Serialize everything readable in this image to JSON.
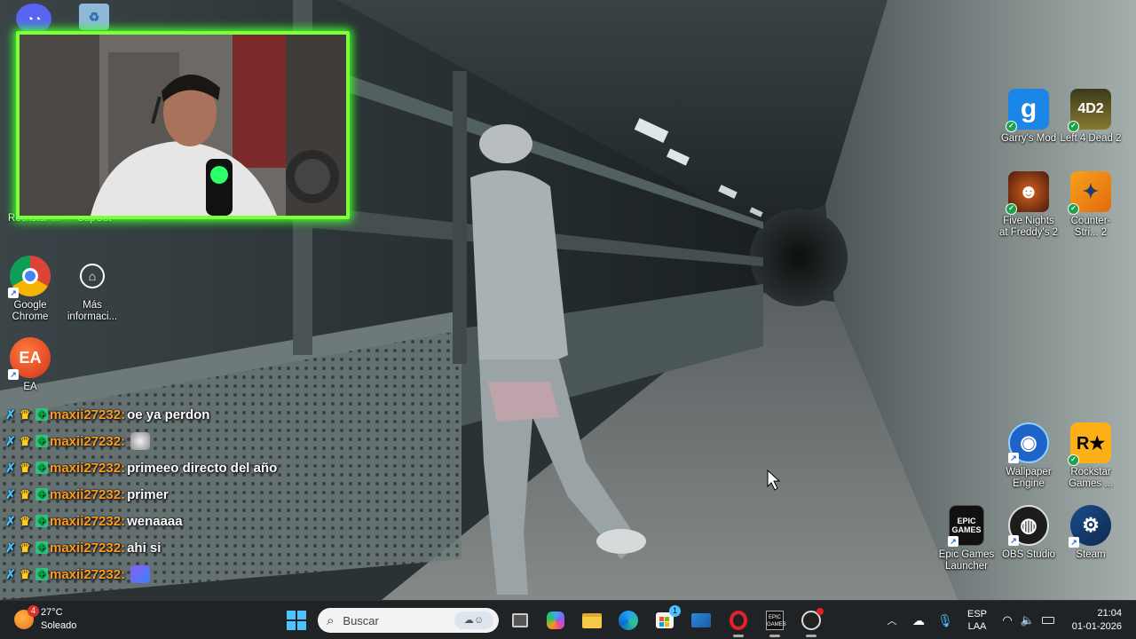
{
  "desktop": {
    "left_icons": [
      {
        "label": "Rockstar ...",
        "icon": "rockstar-icon"
      },
      {
        "label": "CapCut",
        "icon": "capcut-icon"
      },
      {
        "label": "Google Chrome",
        "icon": "chrome-icon"
      },
      {
        "label": "Más informaci...",
        "icon": "info-icon"
      },
      {
        "label": "EA",
        "icon": "ea-icon"
      }
    ],
    "right_icons": [
      {
        "label": "Garry's Mod",
        "icon": "gmod-icon",
        "glyph": "g"
      },
      {
        "label": "Left 4 Dead 2",
        "icon": "l4d2-icon",
        "glyph": "2"
      },
      {
        "label": "Five Nights at Freddy's 2",
        "icon": "fnaf2-icon",
        "glyph": "☻"
      },
      {
        "label": "Counter-Stri... 2",
        "icon": "cs2-icon",
        "glyph": "✦"
      },
      {
        "label": "Wallpaper Engine",
        "icon": "wallpaper-engine-icon",
        "glyph": "◉"
      },
      {
        "label": "Rockstar Games ...",
        "icon": "rockstar-games-icon",
        "glyph": "R★"
      },
      {
        "label": "Epic Games Launcher",
        "icon": "epic-games-icon",
        "glyph": "EPIC GAMES"
      },
      {
        "label": "OBS Studio",
        "icon": "obs-icon",
        "glyph": "◍"
      },
      {
        "label": "Steam",
        "icon": "steam-icon",
        "glyph": "⚙"
      }
    ]
  },
  "chat": {
    "messages": [
      {
        "user": "maxii27232:",
        "text": "oe ya perdon",
        "emote": null
      },
      {
        "user": "maxii27232:",
        "text": "",
        "emote": "cat-emote"
      },
      {
        "user": "maxii27232:",
        "text": "primeeo directo del año",
        "emote": null
      },
      {
        "user": "maxii27232:",
        "text": "primer",
        "emote": null
      },
      {
        "user": "maxii27232:",
        "text": "wenaaaa",
        "emote": null
      },
      {
        "user": "maxii27232:",
        "text": "ahi si",
        "emote": null
      },
      {
        "user": "maxii27232:",
        "text": "",
        "emote": "purple-emote"
      }
    ],
    "colors": {
      "user": "#ff9b1f",
      "text": "#ffffff"
    }
  },
  "taskbar": {
    "weather": {
      "temp": "27°C",
      "condition": "Soleado",
      "notifications": "4"
    },
    "search_placeholder": "Buscar",
    "apps": [
      "windows-start-icon",
      "search-icon",
      "task-view-icon",
      "copilot-icon",
      "file-explorer-icon",
      "edge-icon",
      "microsoft-store-icon",
      "mail-icon",
      "opera-gx-icon",
      "epic-games-taskbar-icon",
      "obs-taskbar-icon"
    ],
    "store_badge": "1",
    "tray": {
      "lang_top": "ESP",
      "lang_bottom": "LAA",
      "time": "21:04",
      "date": "01-01-2026"
    }
  },
  "colors": {
    "webcam_border": "#7dff3a",
    "taskbar": "#1f2326",
    "accent": "#0078d4"
  }
}
